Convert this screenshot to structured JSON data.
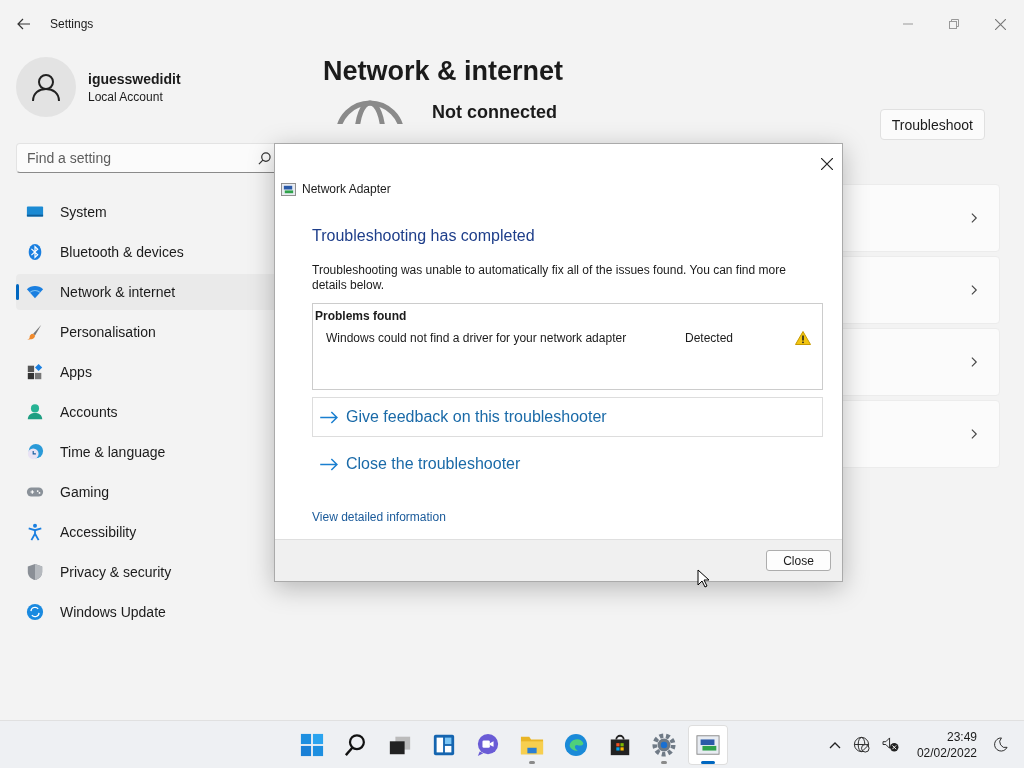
{
  "window": {
    "title": "Settings"
  },
  "account": {
    "name": "iguesswedidit",
    "type": "Local Account"
  },
  "search": {
    "placeholder": "Find a setting"
  },
  "nav": [
    {
      "label": "System",
      "selected": false
    },
    {
      "label": "Bluetooth & devices",
      "selected": false
    },
    {
      "label": "Network & internet",
      "selected": true
    },
    {
      "label": "Personalisation",
      "selected": false
    },
    {
      "label": "Apps",
      "selected": false
    },
    {
      "label": "Accounts",
      "selected": false
    },
    {
      "label": "Time & language",
      "selected": false
    },
    {
      "label": "Gaming",
      "selected": false
    },
    {
      "label": "Accessibility",
      "selected": false
    },
    {
      "label": "Privacy & security",
      "selected": false
    },
    {
      "label": "Windows Update",
      "selected": false
    }
  ],
  "page": {
    "title": "Network & internet",
    "status": "Not connected",
    "action": "Troubleshoot",
    "cards": [
      {
        "kind": "link"
      },
      {
        "kind": "link"
      },
      {
        "kind": "link"
      },
      {
        "kind": "link"
      }
    ]
  },
  "dialog": {
    "title": "Network Adapter",
    "heading": "Troubleshooting has completed",
    "message": "Troubleshooting was unable to automatically fix all of the issues found. You can find more details below.",
    "problems_header": "Problems found",
    "problems": [
      {
        "description": "Windows could not find a driver for your network adapter",
        "status": "Detected"
      }
    ],
    "links": [
      {
        "label": "Give feedback on this troubleshooter",
        "focused": true
      },
      {
        "label": "Close the troubleshooter",
        "focused": false
      }
    ],
    "detail_link": "View detailed information",
    "button": "Close"
  },
  "taskbar": {
    "apps": [
      {
        "running": false,
        "selected": false
      },
      {
        "running": false,
        "selected": false
      },
      {
        "running": false,
        "selected": false
      },
      {
        "running": false,
        "selected": false
      },
      {
        "running": false,
        "selected": false
      },
      {
        "running": true,
        "selected": false
      },
      {
        "running": false,
        "selected": false
      },
      {
        "running": false,
        "selected": false
      },
      {
        "running": true,
        "selected": false
      },
      {
        "running": true,
        "selected": true
      }
    ],
    "time": "23:49",
    "date": "02/02/2022"
  }
}
